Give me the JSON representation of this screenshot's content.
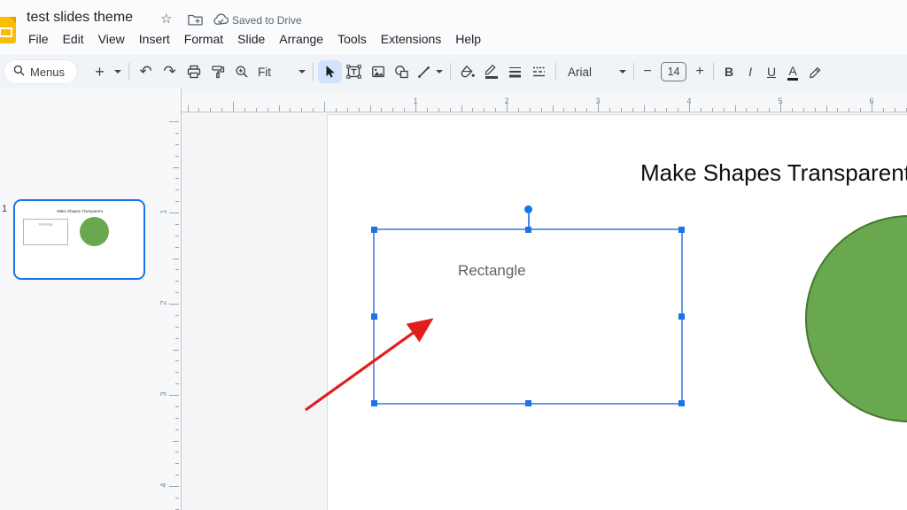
{
  "titlebar": {
    "doc_title": "test slides theme",
    "saved_status": "Saved to Drive",
    "star": "☆"
  },
  "menubar": {
    "items": [
      "File",
      "Edit",
      "View",
      "Insert",
      "Format",
      "Slide",
      "Arrange",
      "Tools",
      "Extensions",
      "Help"
    ]
  },
  "toolbar": {
    "menus_label": "Menus",
    "new_slide_label": "+",
    "undo_glyph": "↶",
    "redo_glyph": "↷",
    "zoom_fit_label": "Fit",
    "font_name": "Arial",
    "font_size_minus": "−",
    "font_size": "14",
    "font_size_plus": "+",
    "bold_label": "B",
    "italic_label": "I",
    "underline_label": "U",
    "text_color_label": "A"
  },
  "filmstrip": {
    "slide_number": "1"
  },
  "rulers": {
    "horizontal": [
      "1",
      "2",
      "3",
      "4",
      "5",
      "6"
    ],
    "vertical": [
      "1",
      "2",
      "3",
      "4"
    ]
  },
  "slide": {
    "title": "Make Shapes Transparent",
    "rectangle_label": "Rectangle"
  },
  "thumbnail": {
    "title": "Make Shapes Transparent",
    "rectangle_label": "Rectangle"
  },
  "colors": {
    "accent_blue": "#1a73e8",
    "selection_border": "#6e96e2",
    "shape_green": "#6aa84f",
    "shape_green_border": "#46772f",
    "arrow_red": "#e11d1d",
    "slides_yellow": "#fbbc04"
  }
}
